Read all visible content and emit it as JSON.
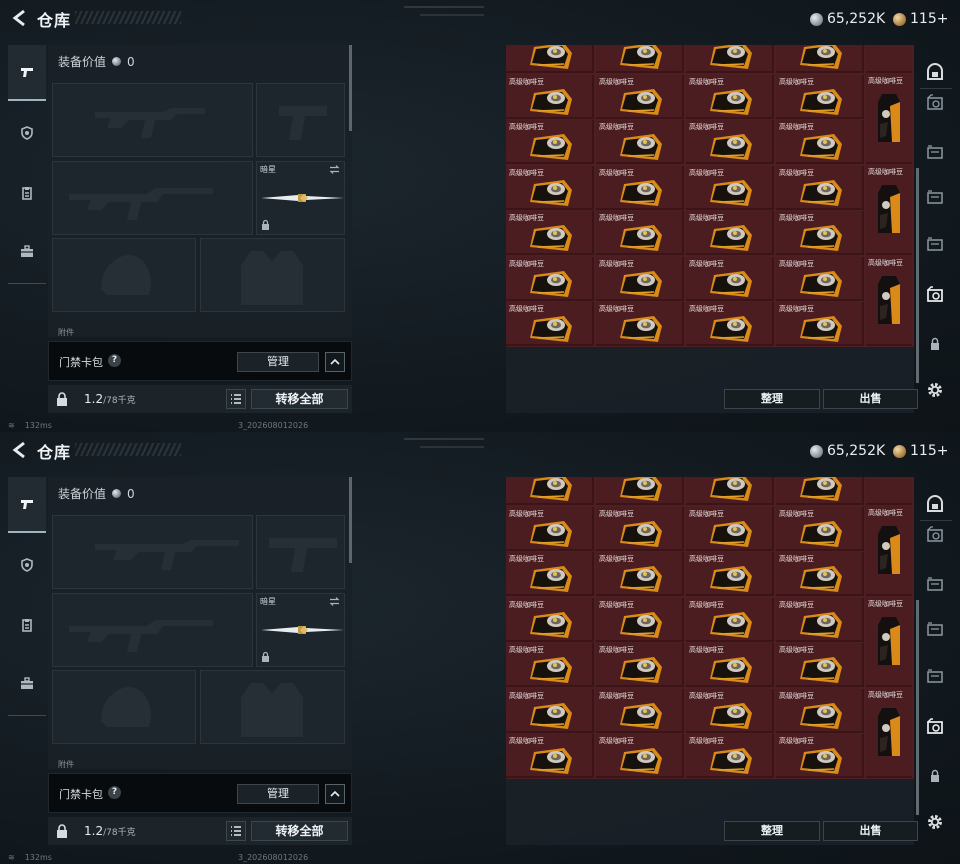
{
  "header": {
    "title": "仓库",
    "currency_silver": "65,252K",
    "currency_gold": "115+"
  },
  "left_rail": {
    "items": [
      "pistol-icon",
      "shield-icon",
      "clipboard-icon",
      "toolbox-icon"
    ]
  },
  "equipment": {
    "value_label": "装备价值",
    "value": "0",
    "melee_name": "暗星",
    "attachments_label": "附件"
  },
  "access_card": {
    "label": "门禁卡包",
    "help": "?",
    "manage_label": "管理"
  },
  "capacity": {
    "value": "1.2",
    "max": "/78千克",
    "transfer_all_label": "转移全部"
  },
  "status": {
    "ping": "132ms",
    "build": "3_202608012026"
  },
  "storage": {
    "item_name": "高级咖啡豆",
    "sort_label": "整理",
    "sell_label": "出售"
  },
  "colors": {
    "grid_bg": "#4c1d20",
    "panel_bg": "#1a2127",
    "accent": "#9fb5c0"
  }
}
